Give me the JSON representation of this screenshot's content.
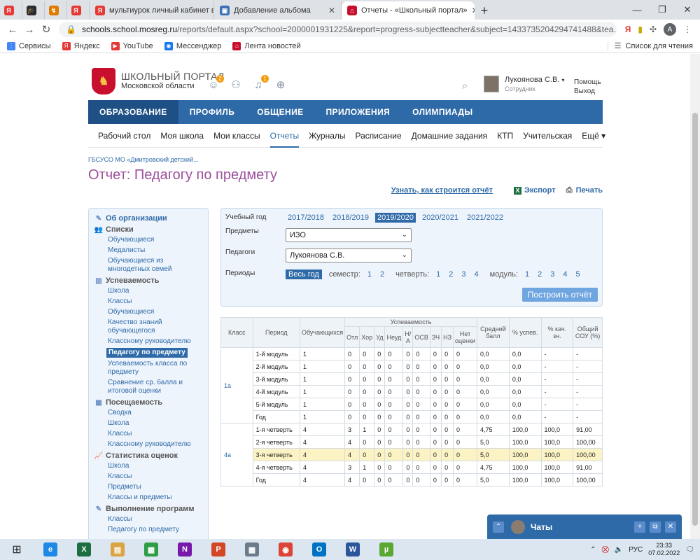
{
  "browser": {
    "tabs": [
      {
        "label": "",
        "icon": "Я",
        "color": "#e53935",
        "small": true
      },
      {
        "label": "",
        "icon": "🎓",
        "color": "#2b2b2b",
        "small": true
      },
      {
        "label": "",
        "icon": "↯",
        "color": "#e07b00",
        "small": true
      },
      {
        "label": "",
        "icon": "Я",
        "color": "#e53935",
        "small": true
      },
      {
        "label": "мультиурок личный кабинет вх",
        "icon": "Я",
        "color": "#e53935",
        "small": false,
        "width": 178
      },
      {
        "label": "Добавление альбома",
        "icon": "▣",
        "color": "#3b6fb6",
        "small": false,
        "width": 182
      },
      {
        "label": "Отчеты - «Школьный портал»",
        "icon": "⌂",
        "color": "#c8102e",
        "small": false,
        "width": 190,
        "active": true
      }
    ],
    "address": {
      "host": "schools.school.mosreg.ru",
      "path": "/reports/default.aspx?school=2000001931225&report=progress-subjectteacher&subject=1433735204294741488&tea..."
    },
    "bookmarks": [
      {
        "label": "Сервисы",
        "icon": "⋮",
        "color": "#4285f4"
      },
      {
        "label": "Яндекс",
        "icon": "Я",
        "color": "#e53935"
      },
      {
        "label": "YouTube",
        "icon": "▶",
        "color": "#e53935"
      },
      {
        "label": "Мессенджер",
        "icon": "◉",
        "color": "#1877f2"
      },
      {
        "label": "Лента новостей",
        "icon": "⌂",
        "color": "#c8102e"
      }
    ],
    "reading_list": "Список для чтения"
  },
  "site": {
    "logo_line1": "ШКОЛЬНЫЙ ПОРТАЛ",
    "logo_line2": "Московской области",
    "badges": {
      "messages": "2",
      "notifications": "1"
    },
    "user_name": "Лукоянова С.В.",
    "user_role": "Сотрудник",
    "help": "Помощь",
    "logout": "Выход",
    "main_nav": [
      "ОБРАЗОВАНИЕ",
      "ПРОФИЛЬ",
      "ОБЩЕНИЕ",
      "ПРИЛОЖЕНИЯ",
      "ОЛИМПИАДЫ"
    ],
    "sub_nav": [
      "Рабочий стол",
      "Моя школа",
      "Мои классы",
      "Отчеты",
      "Журналы",
      "Расписание",
      "Домашние задания",
      "КТП",
      "Учительская"
    ],
    "sub_nav_more": "Ещё ▾",
    "breadcrumb": "ГБСУСО МО «Дмитровский детский...",
    "page_title": "Отчет: Педагогу по предмету",
    "learn_link": "Узнать, как строится отчёт",
    "export": "Экспорт",
    "print": "Печать"
  },
  "sidebar": {
    "org": "Об организации",
    "sections": [
      {
        "title": "Списки",
        "icon": "👥",
        "items": [
          "Обучающиеся",
          "Медалисты",
          "Обучающиеся из многодетных семей"
        ]
      },
      {
        "title": "Успеваемость",
        "icon": "▥",
        "items": [
          "Школа",
          "Классы",
          "Обучающиеся",
          "Качество знаний обучающегося",
          "Классному руководителю",
          "Педагогу по предмету",
          "Успеваемость класса по предмету",
          "Сравнение ср. балла и итоговой оценки"
        ]
      },
      {
        "title": "Посещаемость",
        "icon": "▦",
        "items": [
          "Сводка",
          "Школа",
          "Классы",
          "Классному руководителю"
        ]
      },
      {
        "title": "Статистика оценок",
        "icon": "📈",
        "items": [
          "Школа",
          "Классы",
          "Предметы",
          "Классы и предметы"
        ]
      },
      {
        "title": "Выполнение программ",
        "icon": "✎",
        "items": [
          "Классы",
          "Педагогу по предмету"
        ]
      }
    ],
    "active_item": "Педагогу по предмету"
  },
  "filter": {
    "year_label": "Учебный год",
    "years": [
      "2017/2018",
      "2018/2019",
      "2019/2020",
      "2020/2021",
      "2021/2022"
    ],
    "selected_year": "2019/2020",
    "subjects_label": "Предметы",
    "subject_value": "ИЗО",
    "teachers_label": "Педагоги",
    "teacher_value": "Лукоянова С.В.",
    "periods_label": "Периоды",
    "all_year": "Весь год",
    "semester_label": "семестр:",
    "semesters": [
      "1",
      "2"
    ],
    "quarter_label": "четверть:",
    "quarters": [
      "1",
      "2",
      "3",
      "4"
    ],
    "module_label": "модуль:",
    "modules": [
      "1",
      "2",
      "3",
      "4",
      "5"
    ],
    "build_button": "Построить отчёт"
  },
  "table": {
    "headers": {
      "class": "Класс",
      "period": "Период",
      "students": "Обучающихся",
      "progress": "Успеваемость",
      "avg": "Средний балл",
      "pct_pass": "% успев.",
      "pct_quality": "% кач. зн.",
      "sou": "Общий СОУ (%)"
    },
    "subheaders": [
      "Отл",
      "Хор",
      "Уд",
      "Неуд",
      "Н/А",
      "ОСВ",
      "ЗЧ",
      "НЗ",
      "Нет оценки"
    ],
    "groups": [
      {
        "class": "1а",
        "rows": [
          {
            "period": "1-й модуль",
            "students": "1",
            "marks": [
              "0",
              "0",
              "0",
              "0",
              "0",
              "0",
              "0",
              "0",
              "0"
            ],
            "avg": "0,0",
            "pass": "0,0",
            "quality": "-",
            "sou": "-"
          },
          {
            "period": "2-й модуль",
            "students": "1",
            "marks": [
              "0",
              "0",
              "0",
              "0",
              "0",
              "0",
              "0",
              "0",
              "0"
            ],
            "avg": "0,0",
            "pass": "0,0",
            "quality": "-",
            "sou": "-"
          },
          {
            "period": "3-й модуль",
            "students": "1",
            "marks": [
              "0",
              "0",
              "0",
              "0",
              "0",
              "0",
              "0",
              "0",
              "0"
            ],
            "avg": "0,0",
            "pass": "0,0",
            "quality": "-",
            "sou": "-"
          },
          {
            "period": "4-й модуль",
            "students": "1",
            "marks": [
              "0",
              "0",
              "0",
              "0",
              "0",
              "0",
              "0",
              "0",
              "0"
            ],
            "avg": "0,0",
            "pass": "0,0",
            "quality": "-",
            "sou": "-"
          },
          {
            "period": "5-й модуль",
            "students": "1",
            "marks": [
              "0",
              "0",
              "0",
              "0",
              "0",
              "0",
              "0",
              "0",
              "0"
            ],
            "avg": "0,0",
            "pass": "0,0",
            "quality": "-",
            "sou": "-"
          },
          {
            "period": "Год",
            "students": "1",
            "marks": [
              "0",
              "0",
              "0",
              "0",
              "0",
              "0",
              "0",
              "0",
              "0"
            ],
            "avg": "0,0",
            "pass": "0,0",
            "quality": "-",
            "sou": "-"
          }
        ]
      },
      {
        "class": "4а",
        "rows": [
          {
            "period": "1-я четверть",
            "students": "4",
            "marks": [
              "3",
              "1",
              "0",
              "0",
              "0",
              "0",
              "0",
              "0",
              "0"
            ],
            "avg": "4,75",
            "pass": "100,0",
            "quality": "100,0",
            "sou": "91,00"
          },
          {
            "period": "2-я четверть",
            "students": "4",
            "marks": [
              "4",
              "0",
              "0",
              "0",
              "0",
              "0",
              "0",
              "0",
              "0"
            ],
            "avg": "5,0",
            "pass": "100,0",
            "quality": "100,0",
            "sou": "100,00"
          },
          {
            "period": "3-я четверть",
            "students": "4",
            "marks": [
              "4",
              "0",
              "0",
              "0",
              "0",
              "0",
              "0",
              "0",
              "0"
            ],
            "avg": "5,0",
            "pass": "100,0",
            "quality": "100,0",
            "sou": "100,00",
            "highlight": true
          },
          {
            "period": "4-я четверть",
            "students": "4",
            "marks": [
              "3",
              "1",
              "0",
              "0",
              "0",
              "0",
              "0",
              "0",
              "0"
            ],
            "avg": "4,75",
            "pass": "100,0",
            "quality": "100,0",
            "sou": "91,00"
          },
          {
            "period": "Год",
            "students": "4",
            "marks": [
              "4",
              "0",
              "0",
              "0",
              "0",
              "0",
              "0",
              "0",
              "0"
            ],
            "avg": "5,0",
            "pass": "100,0",
            "quality": "100,0",
            "sou": "100,00"
          }
        ]
      }
    ]
  },
  "chat": {
    "title": "Чаты"
  },
  "taskbar": {
    "apps": [
      {
        "name": "edge",
        "glyph": "e",
        "color": "#1e88e5"
      },
      {
        "name": "excel",
        "glyph": "X",
        "color": "#1d6f42"
      },
      {
        "name": "files",
        "glyph": "▤",
        "color": "#d9a441"
      },
      {
        "name": "store",
        "glyph": "▦",
        "color": "#2e9e44"
      },
      {
        "name": "onenote",
        "glyph": "N",
        "color": "#7719aa"
      },
      {
        "name": "powerpoint",
        "glyph": "P",
        "color": "#d24726"
      },
      {
        "name": "calculator",
        "glyph": "▦",
        "color": "#6b7b8c"
      },
      {
        "name": "chrome",
        "glyph": "◉",
        "color": "#db4437"
      },
      {
        "name": "outlook",
        "glyph": "O",
        "color": "#0072c6"
      },
      {
        "name": "word",
        "glyph": "W",
        "color": "#2b579a"
      },
      {
        "name": "utorrent",
        "glyph": "µ",
        "color": "#5aa832"
      }
    ],
    "lang": "РУС",
    "time": "23:33",
    "date": "07.02.2022"
  }
}
